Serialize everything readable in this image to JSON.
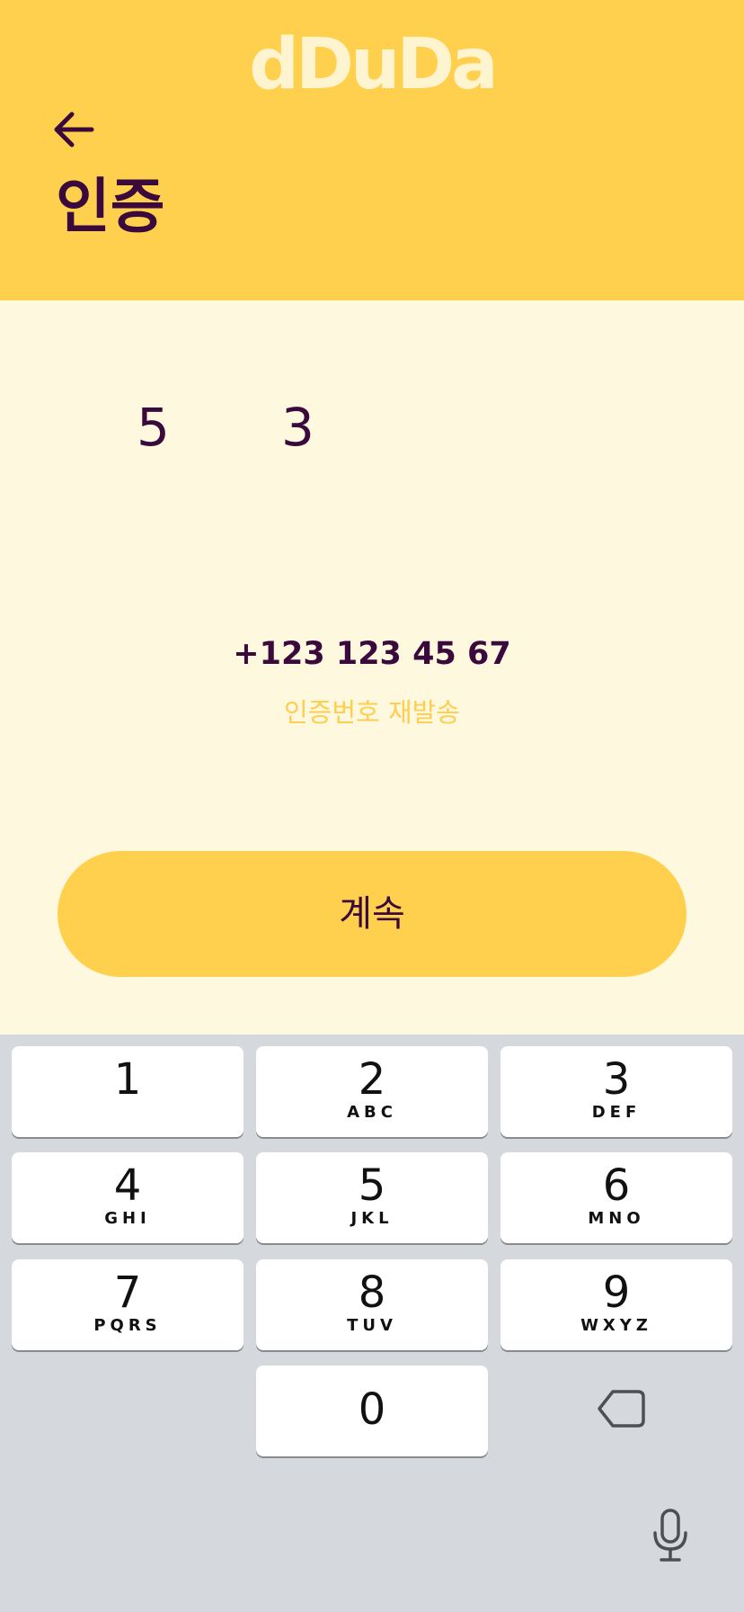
{
  "header": {
    "logo_text": "dDuDa",
    "title": "인증"
  },
  "code": {
    "digit_1": "5",
    "digit_2": "3"
  },
  "phone_number": "+123 123 45 67",
  "resend_label": "인증번호 재발송",
  "continue_label": "계속",
  "keyboard": {
    "keys": [
      {
        "num": "1",
        "letters": ""
      },
      {
        "num": "2",
        "letters": "ABC"
      },
      {
        "num": "3",
        "letters": "DEF"
      },
      {
        "num": "4",
        "letters": "GHI"
      },
      {
        "num": "5",
        "letters": "JKL"
      },
      {
        "num": "6",
        "letters": "MNO"
      },
      {
        "num": "7",
        "letters": "PQRS"
      },
      {
        "num": "8",
        "letters": "TUV"
      },
      {
        "num": "9",
        "letters": "WXYZ"
      },
      {
        "num": "0",
        "letters": ""
      }
    ]
  },
  "colors": {
    "accent": "#ffd04e",
    "background": "#fef8df",
    "text": "#3b0a3d",
    "keyboard": "#d5d8dc"
  },
  "icons": {
    "back": "arrow-left-icon",
    "backspace": "backspace-icon",
    "mic": "microphone-icon"
  }
}
